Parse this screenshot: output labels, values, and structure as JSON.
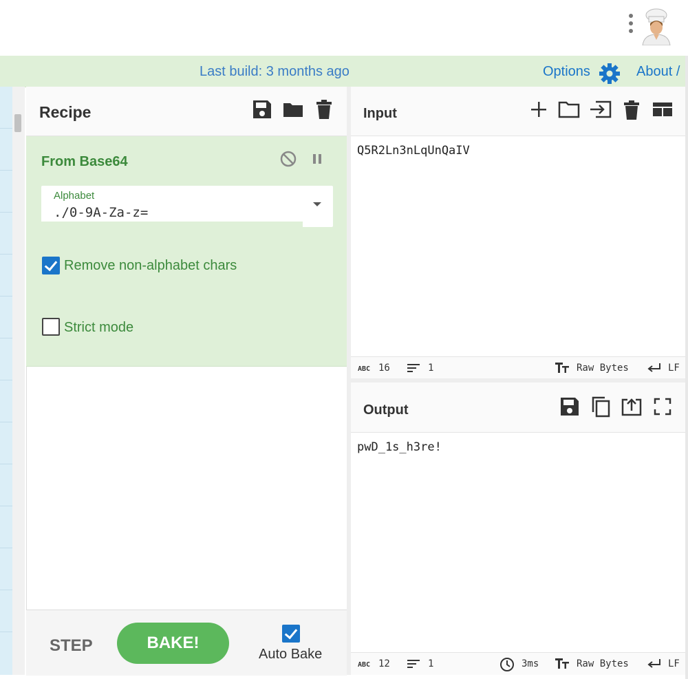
{
  "header": {
    "build_text": "Last build: 3 months ago",
    "options_label": "Options",
    "about_label": "About /"
  },
  "recipe": {
    "title": "Recipe",
    "operation": {
      "name": "From Base64",
      "alphabet_label": "Alphabet",
      "alphabet_value": "./0-9A-Za-z=",
      "remove_non_alphabet_label": "Remove non-alphabet chars",
      "remove_non_alphabet_checked": true,
      "strict_mode_label": "Strict mode",
      "strict_mode_checked": false
    },
    "step_label": "STEP",
    "bake_label": "BAKE!",
    "auto_bake_label": "Auto Bake",
    "auto_bake_checked": true
  },
  "input": {
    "title": "Input",
    "text": "Q5R2Ln3nLqUnQaIV",
    "length": "16",
    "lines": "1",
    "encoding": "Raw Bytes",
    "eol": "LF"
  },
  "output": {
    "title": "Output",
    "text": "pwD_1s_h3re!",
    "length": "12",
    "lines": "1",
    "time": "3ms",
    "encoding": "Raw Bytes",
    "eol": "LF"
  },
  "status_icons": {
    "abc": "ABC"
  },
  "colors": {
    "banner_bg": "#dff0d8",
    "link_blue": "#1a75c9",
    "op_green": "#3c8a3c",
    "bake_green": "#5cb85c"
  }
}
